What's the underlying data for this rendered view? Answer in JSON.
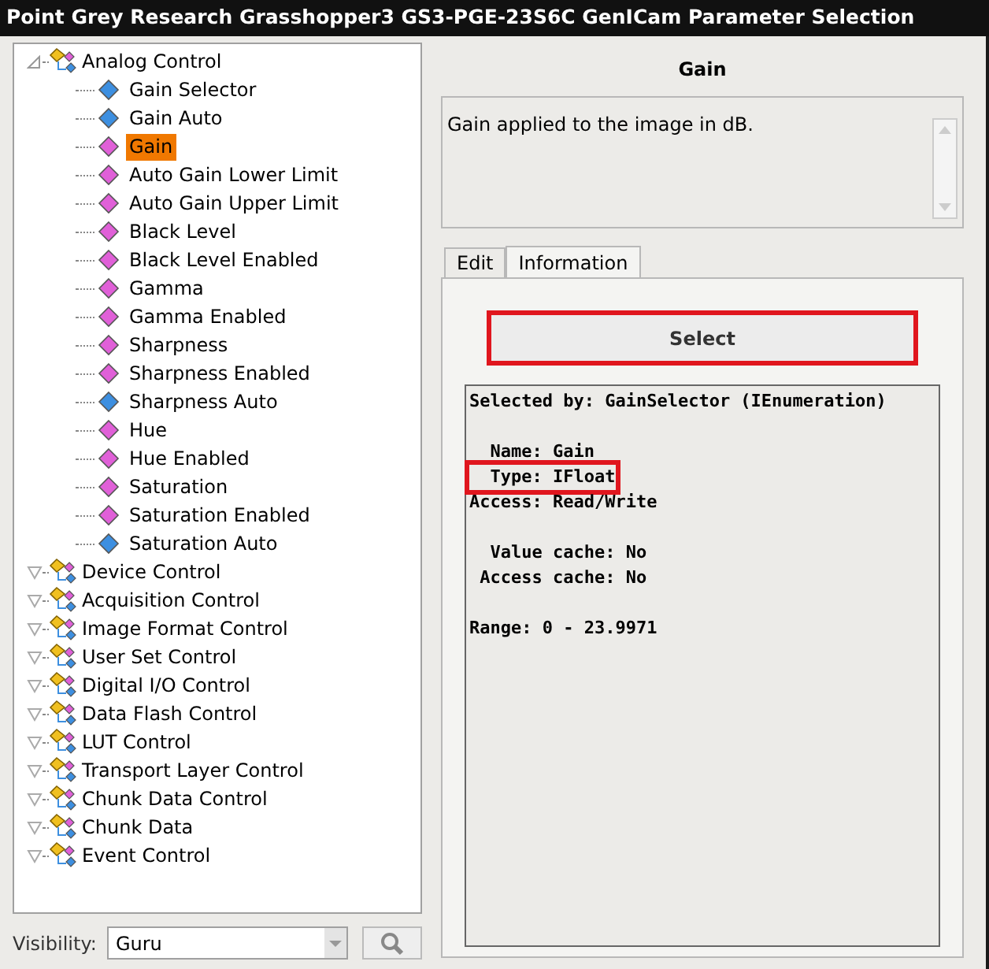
{
  "window": {
    "title": "Point Grey Research Grasshopper3 GS3-PGE-23S6C GenICam Parameter Selection"
  },
  "tree": [
    {
      "label": "Analog Control",
      "expanded": true,
      "children": [
        {
          "label": "Gain Selector",
          "color": "#3d8fe0",
          "selected": false
        },
        {
          "label": "Gain Auto",
          "color": "#3d8fe0",
          "selected": false
        },
        {
          "label": "Gain",
          "color": "#e060d8",
          "selected": true
        },
        {
          "label": "Auto Gain Lower Limit",
          "color": "#e060d8",
          "selected": false
        },
        {
          "label": "Auto Gain Upper Limit",
          "color": "#e060d8",
          "selected": false
        },
        {
          "label": "Black Level",
          "color": "#e060d8",
          "selected": false
        },
        {
          "label": "Black Level Enabled",
          "color": "#e060d8",
          "selected": false
        },
        {
          "label": "Gamma",
          "color": "#e060d8",
          "selected": false
        },
        {
          "label": "Gamma Enabled",
          "color": "#e060d8",
          "selected": false
        },
        {
          "label": "Sharpness",
          "color": "#e060d8",
          "selected": false
        },
        {
          "label": "Sharpness Enabled",
          "color": "#e060d8",
          "selected": false
        },
        {
          "label": "Sharpness Auto",
          "color": "#3d8fe0",
          "selected": false
        },
        {
          "label": "Hue",
          "color": "#e060d8",
          "selected": false
        },
        {
          "label": "Hue Enabled",
          "color": "#e060d8",
          "selected": false
        },
        {
          "label": "Saturation",
          "color": "#e060d8",
          "selected": false
        },
        {
          "label": "Saturation Enabled",
          "color": "#e060d8",
          "selected": false
        },
        {
          "label": "Saturation Auto",
          "color": "#3d8fe0",
          "selected": false
        }
      ]
    },
    {
      "label": "Device Control",
      "expanded": false
    },
    {
      "label": "Acquisition Control",
      "expanded": false
    },
    {
      "label": "Image Format Control",
      "expanded": false
    },
    {
      "label": "User Set Control",
      "expanded": false
    },
    {
      "label": "Digital I/O Control",
      "expanded": false
    },
    {
      "label": "Data Flash Control",
      "expanded": false
    },
    {
      "label": "LUT Control",
      "expanded": false
    },
    {
      "label": "Transport Layer Control",
      "expanded": false
    },
    {
      "label": "Chunk Data Control",
      "expanded": false
    },
    {
      "label": "Chunk Data",
      "expanded": false
    },
    {
      "label": "Event Control",
      "expanded": false
    }
  ],
  "visibility": {
    "label": "Visibility:",
    "value": "Guru"
  },
  "detail": {
    "title": "Gain",
    "description": "Gain applied to the image in dB.",
    "tabs": [
      {
        "label": "Edit",
        "selected": false
      },
      {
        "label": "Information",
        "selected": true
      }
    ],
    "select_button": {
      "label": "Select",
      "highlighted": true
    },
    "info_blocks": [
      [
        {
          "text": "Selected by: GainSelector (IEnumeration)",
          "highlighted": false
        }
      ],
      [
        {
          "text": "  Name: Gain",
          "highlighted": false
        },
        {
          "text": "  Type: IFloat",
          "highlighted": true
        },
        {
          "text": "Access: Read/Write",
          "highlighted": false
        }
      ],
      [
        {
          "text": "  Value cache: No",
          "highlighted": false
        },
        {
          "text": " Access cache: No",
          "highlighted": false
        }
      ],
      [
        {
          "text": "Range: 0 - 23.9971",
          "highlighted": false
        }
      ]
    ]
  }
}
